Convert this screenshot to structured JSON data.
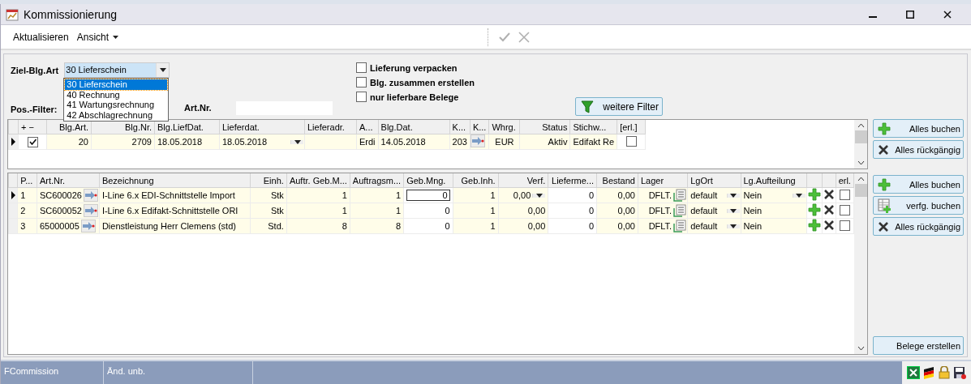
{
  "window": {
    "title": "Kommissionierung"
  },
  "toolbar": {
    "items": [
      {
        "label": "Aktualisieren",
        "kind": "button"
      },
      {
        "label": "Ansicht",
        "kind": "menu"
      }
    ],
    "confirm_disabled": true
  },
  "filter": {
    "target_label": "Ziel-Blg.Art",
    "target_value": "30 Lieferschein",
    "target_expanded": true,
    "target_options": [
      {
        "label": "30 Lieferschein",
        "selected": true
      },
      {
        "label": "40 Rechnung",
        "selected": false
      },
      {
        "label": "41 Wartungsrechnung",
        "selected": false
      },
      {
        "label": "42 Abschlagrechnung",
        "selected": false
      }
    ],
    "pos_filter_label": "Pos.-Filter:",
    "art_nr_label": "Art.Nr.",
    "options": [
      {
        "label": "Lieferung verpacken",
        "checked": false
      },
      {
        "label": "Blg. zusammen erstellen",
        "checked": false
      },
      {
        "label": "nur lieferbare Belege",
        "checked": false
      }
    ],
    "more_filters_button": "weitere Filter"
  },
  "order_grid": {
    "columns": [
      {
        "label": "+ −",
        "kind": "check"
      },
      {
        "label": "Blg.Art.",
        "kind": "num"
      },
      {
        "label": "Blg.Nr.",
        "kind": "num"
      },
      {
        "label": "Blg.LiefDat.",
        "kind": "text"
      },
      {
        "label": "Lieferdat.",
        "kind": "combo"
      },
      {
        "label": "Lieferadr.",
        "kind": "text"
      },
      {
        "label": "A...",
        "kind": "text"
      },
      {
        "label": "Blg.Dat.",
        "kind": "text"
      },
      {
        "label": "K...",
        "kind": "text"
      },
      {
        "label": "K...",
        "kind": "arrow"
      },
      {
        "label": "Whrg.",
        "kind": "center"
      },
      {
        "label": "Status",
        "kind": "num"
      },
      {
        "label": "Stichw...",
        "kind": "text"
      },
      {
        "label": "[erl.]",
        "kind": "check"
      }
    ],
    "rows": [
      {
        "current": true,
        "cells": [
          true,
          "20",
          "2709",
          "18.05.2018",
          "18.05.2018",
          null,
          "Erdi",
          "14.05.2018",
          "203",
          null,
          "EUR",
          "Aktiv",
          "Edifakt Re",
          false
        ]
      }
    ],
    "buttons": [
      {
        "label": "Alles buchen",
        "kind": "plus"
      },
      {
        "label": "Alles rückgängig",
        "kind": "cross"
      }
    ]
  },
  "position_grid": {
    "columns": [
      {
        "label": "P...",
        "kind": "text"
      },
      {
        "label": "Art.Nr.",
        "kind": "arrowtext"
      },
      {
        "label": "Bezeichnung",
        "kind": "text"
      },
      {
        "label": "Einh.",
        "kind": "num"
      },
      {
        "label": "Auftr. Geb.M...",
        "kind": "num"
      },
      {
        "label": "Auftragsm...",
        "kind": "num"
      },
      {
        "label": "Geb.Mng.",
        "kind": "focusedit"
      },
      {
        "label": "Geb.Inh.",
        "kind": "num"
      },
      {
        "label": "Verf.",
        "kind": "numcombo"
      },
      {
        "label": "Lieferme...",
        "kind": "edit"
      },
      {
        "label": "Bestand",
        "kind": "num"
      },
      {
        "label": "Lager",
        "kind": "lager"
      },
      {
        "label": "LgOrt",
        "kind": "combo"
      },
      {
        "label": "Lg.Aufteilung",
        "kind": "textcombo"
      },
      {
        "kind": "plus"
      },
      {
        "kind": "cross"
      },
      {
        "label": "erl.",
        "kind": "check"
      }
    ],
    "rows": [
      {
        "current": true,
        "cells": [
          "1",
          "SC600026",
          "I-Line 6.x EDI-Schnittstelle Import",
          "Stk",
          "1",
          "1",
          "0",
          "1",
          "0,00",
          "0",
          "0,00",
          "DFLT.",
          "default",
          "Nein",
          null,
          null,
          false
        ]
      },
      {
        "current": false,
        "cells": [
          "2",
          "SC600052",
          "I-Line 6.x Edifakt-Schnittstelle ORI",
          "Stk",
          "1",
          "1",
          "0",
          "1",
          "0,00",
          "0",
          "0,00",
          "DFLT.",
          "default",
          "Nein",
          null,
          null,
          false
        ]
      },
      {
        "current": false,
        "cells": [
          "3",
          "65000005",
          "Dienstleistung Herr Clemens (std)",
          "Std.",
          "8",
          "8",
          "0",
          "1",
          "0,00",
          "0",
          "0,00",
          "DFLT.",
          "default",
          "Nein",
          null,
          null,
          false
        ]
      }
    ],
    "buttons": [
      {
        "label": "Alles buchen",
        "kind": "plus"
      },
      {
        "label": "verfg. buchen",
        "kind": "tableplus"
      },
      {
        "label": "Alles rückgängig",
        "kind": "cross"
      }
    ],
    "create_button": "Belege erstellen"
  },
  "status_bar": {
    "fields": [
      "FCommission",
      "Änd. unb."
    ]
  }
}
